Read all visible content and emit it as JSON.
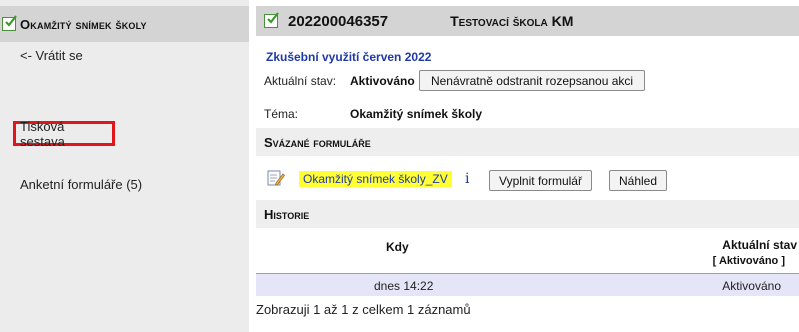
{
  "sidebar": {
    "title": "Okamžitý snímek školy",
    "back_label": "<- Vrátit se",
    "print_label": "Tisková sestava",
    "forms_label": "Anketní formuláře (5)"
  },
  "header": {
    "id": "202200046357",
    "school": "Testovací škola KM"
  },
  "detail": {
    "exam_title": "Zkušební využití červen 2022",
    "state_label": "Aktuální stav:",
    "state_value": "Aktivováno",
    "delete_button": "Nenávratně odstranit rozepsanou akci",
    "topic_label": "Téma:",
    "topic_value": "Okamžitý snímek školy"
  },
  "linked_forms": {
    "heading": "Svázané formuláře",
    "form_name": "Okamžitý snímek školy_ZV",
    "info_glyph": "i",
    "fill_button": "Vyplnit formulář",
    "preview_button": "Náhled"
  },
  "history": {
    "heading": "Historie",
    "col_when": "Kdy",
    "col_state": "Aktuální stav",
    "col_state_filter": "[ Aktivováno ]",
    "rows": [
      {
        "when": "dnes 14:22",
        "state": "Aktivováno"
      }
    ],
    "paging": "Zobrazuji 1 až 1 z celkem 1 záznamů"
  },
  "icons": {
    "check": "check-square-icon",
    "form": "edit-document-icon",
    "info": "info-icon"
  },
  "colors": {
    "highlight_border": "#e0161b",
    "link_blue": "#1f3aa8",
    "form_highlight": "#ffff33",
    "check_green": "#4a8f3a",
    "row_bg": "#e4e6f8"
  }
}
